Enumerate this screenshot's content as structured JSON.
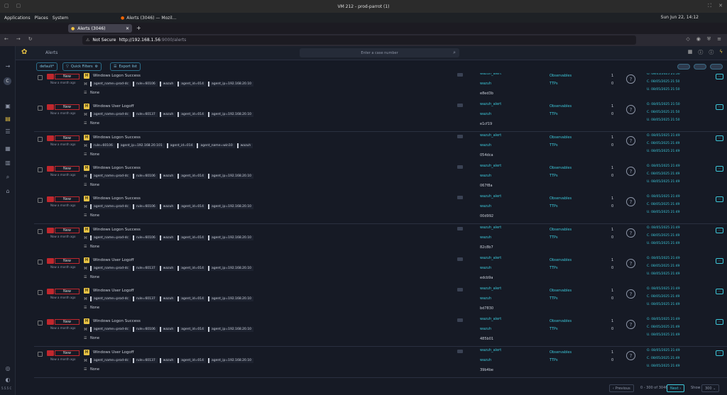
{
  "vm": {
    "title": "VM 212 - prod-parrot (1)"
  },
  "os": {
    "menu": [
      "Applications",
      "Places",
      "System"
    ],
    "task": "Alerts (3046) — Mozil...",
    "clock": "Sun Jun 22, 14:12"
  },
  "browser": {
    "tab_label": "Alerts (3046)",
    "new_tab": "+",
    "not_secure": "Not Secure",
    "url_host": "http://192.168.1.56",
    "url_path": ":9000/alerts"
  },
  "app": {
    "breadcrumb": "Alerts",
    "case_placeholder": "Enter a case number",
    "toolbar": {
      "filter": "default*",
      "quick_filters": "Quick Filters",
      "export": "Export list"
    },
    "sidebar_version": "5.5.5 C"
  },
  "rows": [
    {
      "title": "Windows Logon Success",
      "tags": [
        "agent_name=prod-dc",
        "rule=60106",
        "wazuh",
        "agent_id=014",
        "agent_ip=192.168.20.10"
      ],
      "hash": "e8ed3b",
      "d1": "O. 08/05/2025 21:50",
      "d2": "C. 08/05/2025 21:50",
      "d3": "U. 08/05/2025 21:50"
    },
    {
      "title": "Windows User Logoff",
      "tags": [
        "agent_name=prod-dc",
        "rule=60137",
        "wazuh",
        "agent_id=014",
        "agent_ip=192.168.20.10"
      ],
      "hash": "e1cf19",
      "d1": "O. 08/05/2025 21:50",
      "d2": "C. 08/05/2025 21:50",
      "d3": "U. 08/05/2025 21:50"
    },
    {
      "title": "Windows Logon Success",
      "tags": [
        "rule=60106",
        "agent_ip=192.168.20.101",
        "agent_id=014",
        "agent_name=win10",
        "wazuh"
      ],
      "hash": "054dca",
      "d1": "O. 08/05/2025 21:49",
      "d2": "C. 08/05/2025 21:49",
      "d3": "U. 08/05/2025 21:49"
    },
    {
      "title": "Windows Logon Success",
      "tags": [
        "agent_name=prod-dc",
        "rule=60106",
        "wazuh",
        "agent_id=014",
        "agent_ip=192.168.20.10"
      ],
      "hash": "067f8a",
      "d1": "O. 08/05/2025 21:49",
      "d2": "C. 08/05/2025 21:49",
      "d3": "U. 08/05/2025 21:49"
    },
    {
      "title": "Windows Logon Success",
      "tags": [
        "agent_name=prod-dc",
        "rule=60106",
        "wazuh",
        "agent_id=014",
        "agent_ip=192.168.20.10"
      ],
      "hash": "00d992",
      "d1": "O. 08/05/2025 21:49",
      "d2": "C. 08/05/2025 21:49",
      "d3": "U. 08/05/2025 21:49"
    },
    {
      "title": "Windows Logon Success",
      "tags": [
        "agent_name=prod-dc",
        "rule=60106",
        "wazuh",
        "agent_id=014",
        "agent_ip=192.168.20.10"
      ],
      "hash": "82c8b7",
      "d1": "O. 08/05/2025 21:49",
      "d2": "C. 08/05/2025 21:49",
      "d3": "U. 08/05/2025 21:49"
    },
    {
      "title": "Windows User Logoff",
      "tags": [
        "agent_name=prod-dc",
        "rule=60137",
        "wazuh",
        "agent_id=014",
        "agent_ip=192.168.20.10"
      ],
      "hash": "edcb9a",
      "d1": "O. 08/05/2025 21:49",
      "d2": "C. 08/05/2025 21:49",
      "d3": "U. 08/05/2025 21:49"
    },
    {
      "title": "Windows User Logoff",
      "tags": [
        "agent_name=prod-dc",
        "rule=60137",
        "wazuh",
        "agent_id=014",
        "agent_ip=192.168.20.10"
      ],
      "hash": "bd7830",
      "d1": "O. 08/05/2025 21:49",
      "d2": "C. 08/05/2025 21:49",
      "d3": "U. 08/05/2025 21:49"
    },
    {
      "title": "Windows Logon Success",
      "tags": [
        "agent_name=prod-dc",
        "rule=60106",
        "wazuh",
        "agent_id=014",
        "agent_ip=192.168.20.10"
      ],
      "hash": "485b01",
      "d1": "O. 08/05/2025 21:49",
      "d2": "C. 08/05/2025 21:49",
      "d3": "U. 08/05/2025 21:49"
    },
    {
      "title": "Windows User Logoff",
      "tags": [
        "agent_name=prod-dc",
        "rule=60137",
        "wazuh",
        "agent_id=014",
        "agent_ip=192.168.20.10"
      ],
      "hash": "39b4be",
      "d1": "O. 08/05/2025 21:49",
      "d2": "C. 08/05/2025 21:49",
      "d3": "U. 08/05/2025 21:49"
    }
  ],
  "row_common": {
    "status": "New",
    "ago": "Now a month ago",
    "sev_letter": "M",
    "none": "None",
    "src1": "wazuh_alert",
    "src2": "wazuh",
    "obs": "Observables",
    "ttp": "TTPs",
    "n1": "1",
    "n2": "0",
    "q": "?",
    "more": "···"
  },
  "footer": {
    "previous": "‹ Previous",
    "range": "0 - 300 of 3046",
    "next": "Next ›",
    "show": "Show",
    "show_value": "300"
  }
}
